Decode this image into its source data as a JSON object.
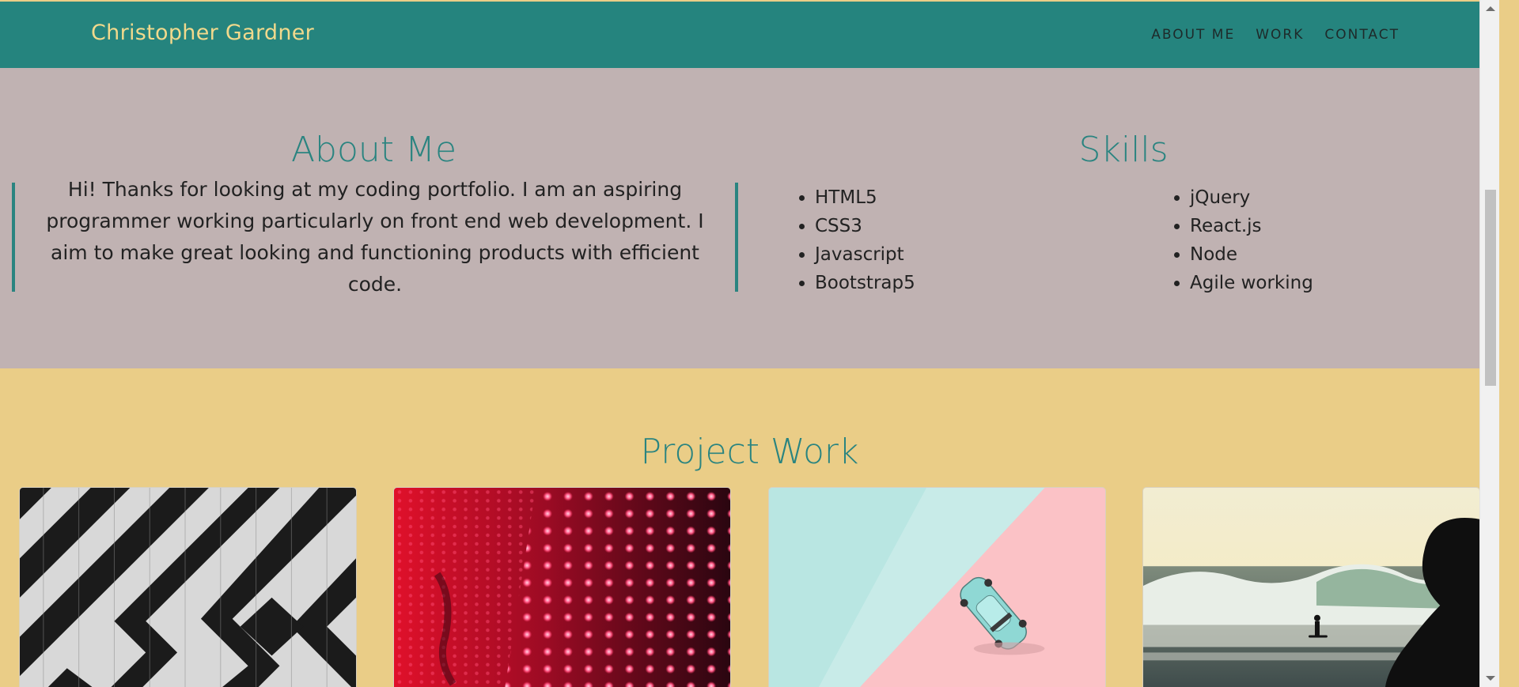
{
  "navbar": {
    "brand": "Christopher Gardner",
    "links": [
      "ABOUT ME",
      "WORK",
      "CONTACT"
    ]
  },
  "about": {
    "title": "About Me",
    "text": "Hi! Thanks for looking at my coding portfolio. I am an aspiring programmer working particularly on front end web development. I aim to make great looking and functioning products with efficient code."
  },
  "skills": {
    "title": "Skills",
    "left": [
      "HTML5",
      "CSS3",
      "Javascript",
      "Bootstrap5"
    ],
    "right": [
      "jQuery",
      "React.js",
      "Node",
      "Agile working"
    ]
  },
  "projects": {
    "title": "Project Work",
    "images": [
      "black-white-diamond-pattern-image",
      "red-led-dots-image",
      "toy-car-pastel-image",
      "surfer-wave-image"
    ]
  },
  "colors": {
    "navbar": "#25847e",
    "brand": "#f1d98c",
    "about_bg": "#c0b2b2",
    "accent": "#2a8480",
    "project_bg": "#eacd87"
  }
}
